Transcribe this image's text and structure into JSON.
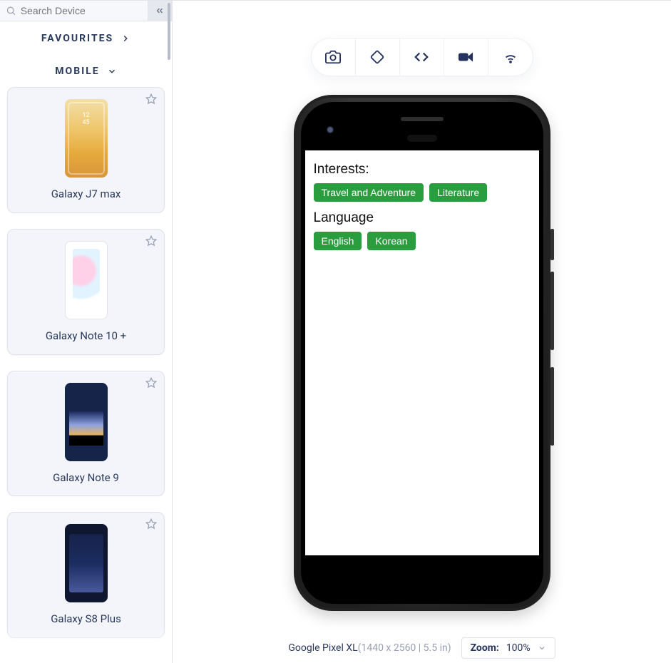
{
  "search": {
    "placeholder": "Search Device"
  },
  "sections": {
    "favourites": "FAVOURITES",
    "mobile": "MOBILE"
  },
  "devices": [
    {
      "name": "Galaxy J7 max",
      "imgClass": "img-gold"
    },
    {
      "name": "Galaxy Note 10 +",
      "imgClass": "img-white"
    },
    {
      "name": "Galaxy Note 9",
      "imgClass": "img-night"
    },
    {
      "name": "Galaxy S8 Plus",
      "imgClass": "img-dark"
    }
  ],
  "toolbar": {
    "screenshot": "Screenshot",
    "rotate": "Rotate",
    "devtools": "Dev Tools",
    "video": "Record",
    "wifi": "Network"
  },
  "screen": {
    "interests_label": "Interests:",
    "interests": [
      "Travel and Adventure",
      "Literature"
    ],
    "language_label": "Language",
    "languages": [
      "English",
      "Korean"
    ]
  },
  "footer": {
    "model": "Google Pixel XL",
    "dims": "(1440 x 2560 | 5.5 in)",
    "zoom_label": "Zoom:",
    "zoom_value": "100%"
  }
}
